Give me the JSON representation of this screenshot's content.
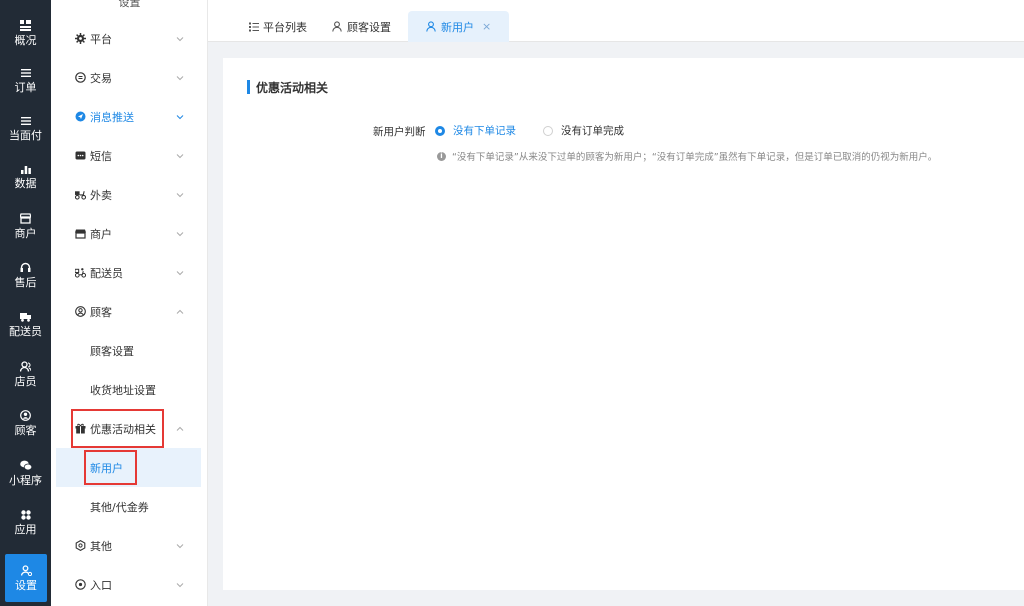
{
  "rail": {
    "items": [
      {
        "label": "概况",
        "icon": "dashboard-icon"
      },
      {
        "label": "订单",
        "icon": "list-icon"
      },
      {
        "label": "当面付",
        "icon": "list-icon"
      },
      {
        "label": "数据",
        "icon": "bar-chart-icon"
      },
      {
        "label": "商户",
        "icon": "store-icon"
      },
      {
        "label": "售后",
        "icon": "headset-icon"
      },
      {
        "label": "配送员",
        "icon": "truck-icon"
      },
      {
        "label": "店员",
        "icon": "user-group-icon"
      },
      {
        "label": "顾客",
        "icon": "user-circle-icon"
      },
      {
        "label": "小程序",
        "icon": "chat-icon"
      },
      {
        "label": "应用",
        "icon": "apps-icon"
      },
      {
        "label": "设置",
        "icon": "settings-user-icon"
      }
    ]
  },
  "sidebar": {
    "header": "设置",
    "menu": [
      {
        "label": "平台",
        "icon": "gear-icon"
      },
      {
        "label": "交易",
        "icon": "exchange-icon"
      },
      {
        "label": "消息推送",
        "icon": "send-icon"
      },
      {
        "label": "短信",
        "icon": "message-icon"
      },
      {
        "label": "外卖",
        "icon": "scooter-icon"
      },
      {
        "label": "商户",
        "icon": "shop-icon"
      },
      {
        "label": "配送员",
        "icon": "delivery-icon"
      },
      {
        "label": "顾客",
        "icon": "user-circle-icon"
      }
    ],
    "customer_sub": [
      "顾客设置",
      "收货地址设置"
    ],
    "promo": {
      "label": "优惠活动相关",
      "icon": "gift-icon"
    },
    "promo_sub": [
      "新用户",
      "其他/代金券"
    ],
    "other": {
      "label": "其他",
      "icon": "settings-icon"
    },
    "entry": {
      "label": "入口",
      "icon": "target-icon"
    }
  },
  "tabs": [
    {
      "label": "平台列表",
      "icon": "list-icon"
    },
    {
      "label": "顾客设置",
      "icon": "user-icon"
    },
    {
      "label": "新用户",
      "icon": "user-icon",
      "close": "×"
    }
  ],
  "content": {
    "section_title": "优惠活动相关",
    "form_label": "新用户判断",
    "options": [
      "没有下单记录",
      "没有订单完成"
    ],
    "selected_index": 0,
    "hint": "“没有下单记录”从来没下过单的顾客为新用户；“没有订单完成”虽然有下单记录，但是订单已取消的仍视为新用户。"
  },
  "colors": {
    "accent": "#1e88e5",
    "rail_bg": "#222b36",
    "highlight": "#e53935"
  }
}
